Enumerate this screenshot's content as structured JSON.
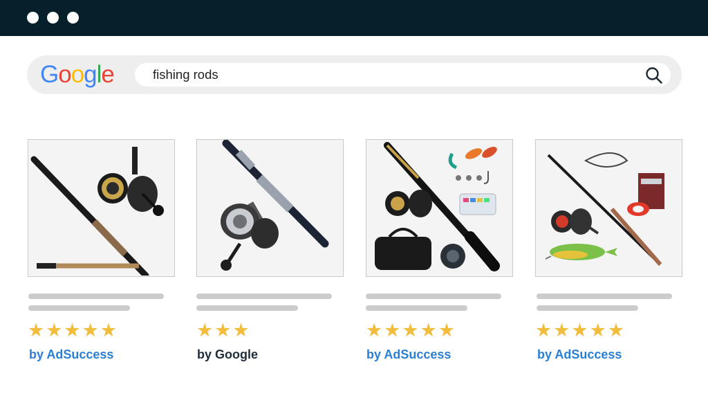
{
  "window": {
    "controls": [
      "window-dot",
      "window-dot",
      "window-dot"
    ]
  },
  "search": {
    "logo_letters": [
      {
        "char": "G",
        "color": "#4285F4"
      },
      {
        "char": "o",
        "color": "#EA4335"
      },
      {
        "char": "o",
        "color": "#FBBC05"
      },
      {
        "char": "g",
        "color": "#4285F4"
      },
      {
        "char": "l",
        "color": "#34A853"
      },
      {
        "char": "e",
        "color": "#EA4335"
      }
    ],
    "query": "fishing rods",
    "icon": "search-icon"
  },
  "products": [
    {
      "image": "spinning-reel-and-rod-photo",
      "stars": "★★★★★",
      "rating": 5,
      "byline": "by AdSuccess",
      "byline_color": "#2a7fd4"
    },
    {
      "image": "rod-with-reel-closeup-photo",
      "stars": "★★★",
      "rating": 3,
      "byline": "by Google",
      "byline_color": "#1f2d3a"
    },
    {
      "image": "telescopic-rod-kit-photo",
      "stars": "★★★★★",
      "rating": 5,
      "byline": "by AdSuccess",
      "byline_color": "#2a7fd4"
    },
    {
      "image": "rod-reel-line-lure-set-photo",
      "stars": "★★★★★",
      "rating": 5,
      "byline": "by AdSuccess",
      "byline_color": "#2a7fd4"
    }
  ],
  "colors": {
    "titlebar": "#06202b",
    "star": "#f2bd3d",
    "placeholder_bar": "#cccccc"
  }
}
